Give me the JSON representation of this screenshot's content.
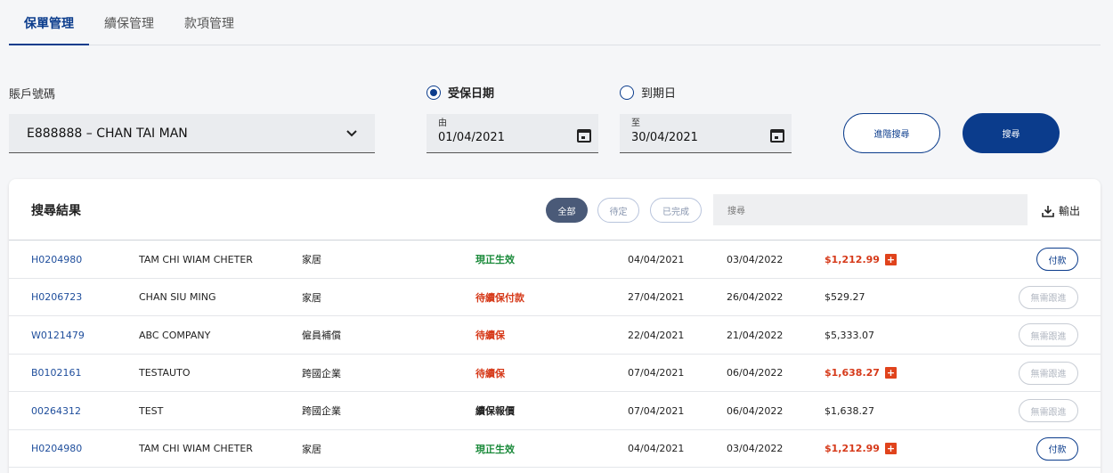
{
  "tabs": [
    "保單管理",
    "續保管理",
    "款項管理"
  ],
  "account": {
    "label": "賬戶號碼",
    "value": "E888888 – CHAN TAI MAN"
  },
  "radios": {
    "start": "受保日期",
    "end": "到期日"
  },
  "date_from": {
    "caption": "由",
    "value": "01/04/2021"
  },
  "date_to": {
    "caption": "至",
    "value": "30/04/2021"
  },
  "buttons": {
    "advanced": "進階搜尋",
    "search": "搜尋"
  },
  "results": {
    "title": "搜尋結果",
    "filters": [
      "全部",
      "待定",
      "已完成"
    ],
    "search_placeholder": "搜尋",
    "export_label": "輸出",
    "rows": [
      {
        "id": "H0204980",
        "name": "TAM CHI WIAM CHETER",
        "type": "家居",
        "status": "現正生效",
        "start": "04/04/2021",
        "end": "03/04/2022",
        "amount": "$1,212.99",
        "action": "付款"
      },
      {
        "id": "H0206723",
        "name": "CHAN SIU MING",
        "type": "家居",
        "status": "待續保付款",
        "start": "27/04/2021",
        "end": "26/04/2022",
        "amount": "$529.27",
        "action": "無需跟進"
      },
      {
        "id": "W0121479",
        "name": "ABC COMPANY",
        "type": "僱員補償",
        "status": "待續保",
        "start": "22/04/2021",
        "end": "21/04/2022",
        "amount": "$5,333.07",
        "action": "無需跟進"
      },
      {
        "id": "B0102161",
        "name": "TESTAUTO",
        "type": "跨國企業",
        "status": "待續保",
        "start": "07/04/2021",
        "end": "06/04/2022",
        "amount": "$1,638.27",
        "action": "無需跟進"
      },
      {
        "id": "00264312",
        "name": "TEST",
        "type": "跨國企業",
        "status": "續保報價",
        "start": "07/04/2021",
        "end": "06/04/2022",
        "amount": "$1,638.27",
        "action": "無需跟進"
      },
      {
        "id": "H0204980",
        "name": "TAM CHI WIAM CHETER",
        "type": "家居",
        "status": "現正生效",
        "start": "04/04/2021",
        "end": "03/04/2022",
        "amount": "$1,212.99",
        "action": "付款"
      }
    ]
  },
  "colors": {
    "primary": "#0b3c8c",
    "alert": "#d63a1a",
    "active": "#1a8a3a",
    "chip_active": "#4a5a78"
  }
}
